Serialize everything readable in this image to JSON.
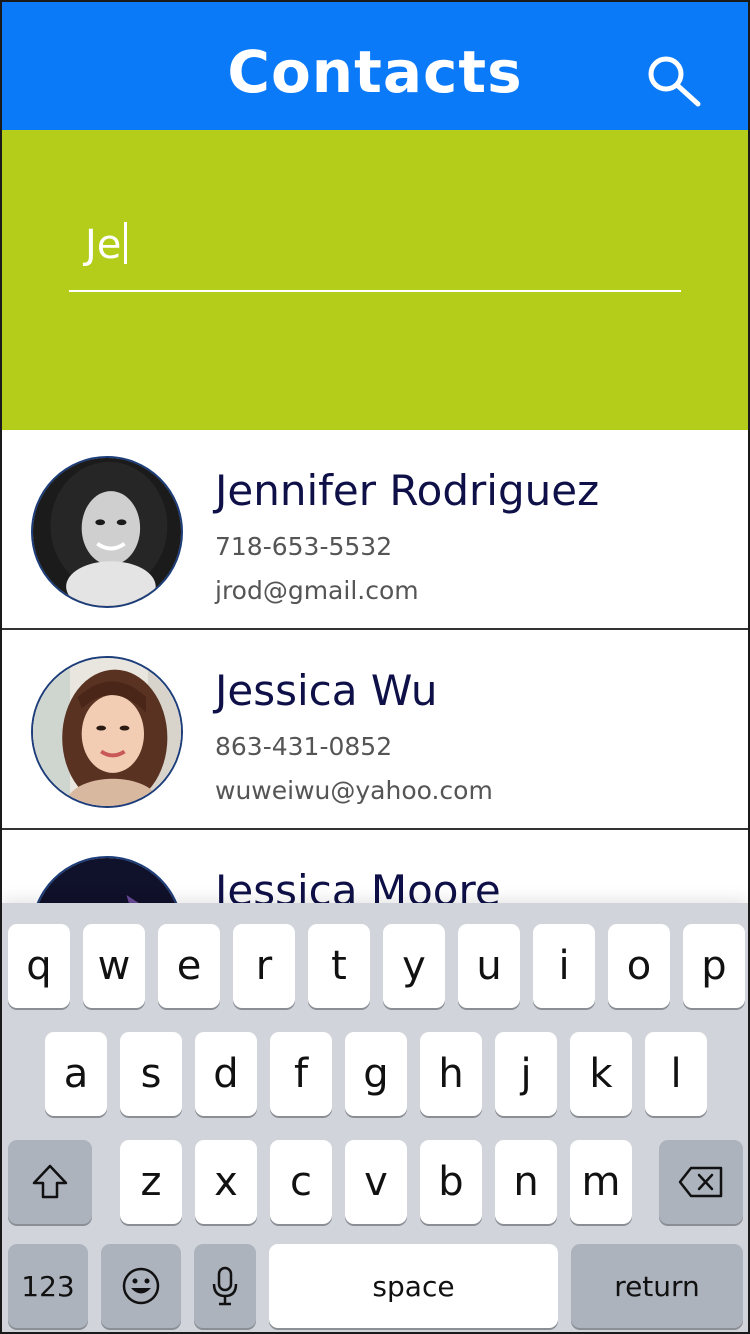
{
  "header": {
    "title": "Contacts",
    "search_icon": "search-icon"
  },
  "search": {
    "value": "Je"
  },
  "contacts": [
    {
      "name": "Jennifer Rodriguez",
      "phone": "718-653-5532",
      "email": "jrod@gmail.com"
    },
    {
      "name": "Jessica Wu",
      "phone": "863-431-0852",
      "email": "wuweiwu@yahoo.com"
    },
    {
      "name": "Jessica Moore"
    }
  ],
  "keyboard": {
    "row1": [
      "q",
      "w",
      "e",
      "r",
      "t",
      "y",
      "u",
      "i",
      "o",
      "p"
    ],
    "row2": [
      "a",
      "s",
      "d",
      "f",
      "g",
      "h",
      "j",
      "k",
      "l"
    ],
    "row3": [
      "z",
      "x",
      "c",
      "v",
      "b",
      "n",
      "m"
    ],
    "numbers_label": "123",
    "space_label": "space",
    "return_label": "return",
    "shift_icon": "shift-icon",
    "delete_icon": "backspace-icon",
    "emoji_icon": "emoji-icon",
    "mic_icon": "microphone-icon"
  },
  "colors": {
    "header_bg": "#0a7af9",
    "search_panel_bg": "#b3cd1a",
    "name_text": "#0e1047",
    "keyboard_bg": "#d1d5db"
  }
}
